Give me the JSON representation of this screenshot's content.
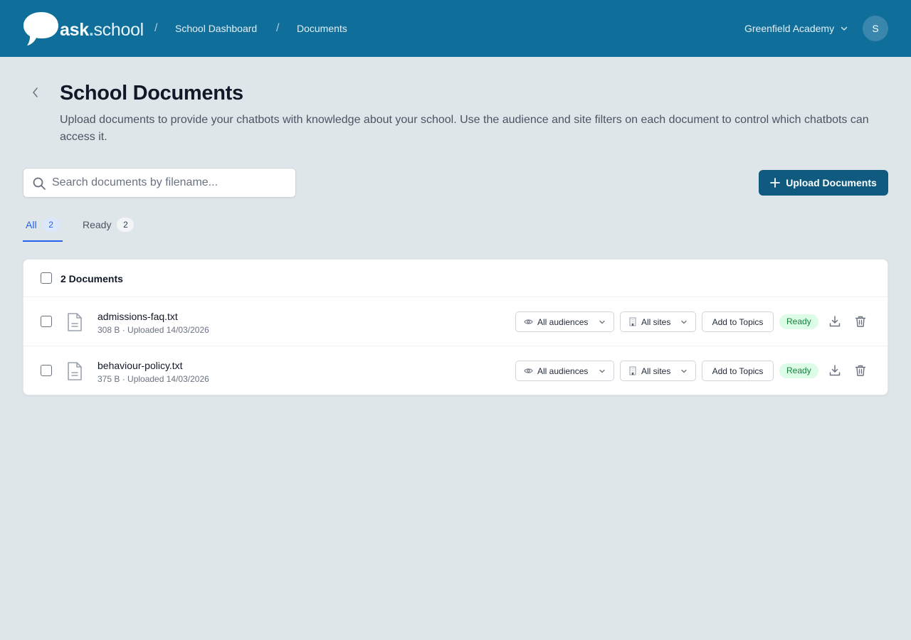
{
  "header": {
    "logo_bold": "ask",
    "logo_dot": ".",
    "logo_rest": "school",
    "breadcrumb": [
      {
        "label": "School Dashboard"
      },
      {
        "label": "Documents"
      }
    ],
    "breadcrumb_separator": "/",
    "school_name": "Greenfield Academy",
    "avatar_initial": "S"
  },
  "page": {
    "title": "School Documents",
    "description": "Upload documents to provide your chatbots with knowledge about your school. Use the audience and site filters on each document to control which chatbots can access it."
  },
  "search": {
    "placeholder": "Search documents by filename...",
    "value": ""
  },
  "upload_button": {
    "label": "Upload Documents"
  },
  "tabs": [
    {
      "label": "All",
      "count": "2",
      "active": true
    },
    {
      "label": "Ready",
      "count": "2",
      "active": false
    }
  ],
  "table": {
    "header_label": "2 Documents",
    "rows": [
      {
        "filename": "admissions-faq.txt",
        "meta": "308 B · Uploaded 14/03/2026",
        "audience": "All audiences",
        "sites": "All sites",
        "topics_label": "Add to Topics",
        "status": "Ready"
      },
      {
        "filename": "behaviour-policy.txt",
        "meta": "375 B · Uploaded 14/03/2026",
        "audience": "All audiences",
        "sites": "All sites",
        "topics_label": "Add to Topics",
        "status": "Ready"
      }
    ]
  },
  "icons": {
    "logo": "speech-bubble-icon",
    "back": "chevron-left-icon",
    "search": "search-icon",
    "upload": "plus-icon",
    "file": "document-icon",
    "audience": "eye-icon",
    "sites": "building-icon",
    "download": "download-icon",
    "delete": "trash-icon",
    "dropdown": "chevron-down-icon"
  },
  "colors": {
    "header_bg": "#106e9a",
    "primary_button": "#0f5a7e",
    "active_tab": "#2563eb",
    "status_ready_bg": "#dcfce7",
    "status_ready_text": "#15803d",
    "page_bg": "#dfe6ea"
  }
}
